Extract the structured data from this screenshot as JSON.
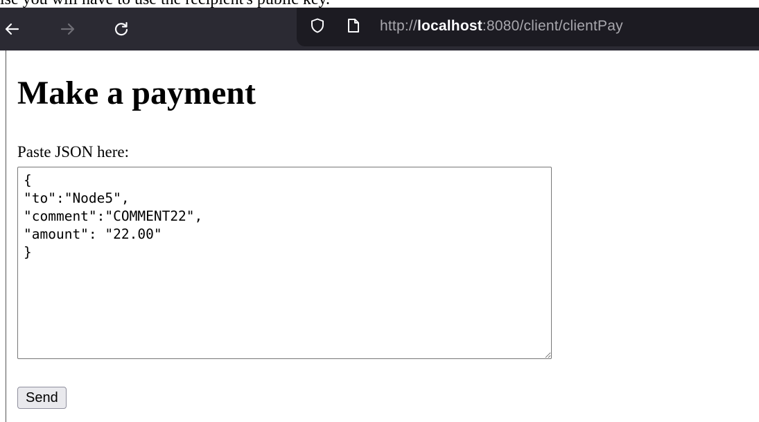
{
  "document_above": {
    "clipped_text": "ise you will have to use the recipient's public key."
  },
  "browser": {
    "back_icon": "back-arrow-icon",
    "forward_icon": "forward-arrow-icon",
    "reload_icon": "reload-icon",
    "tracking_protection_icon": "shield-icon",
    "page_icon": "document-icon",
    "url": {
      "scheme": "http://",
      "host": "localhost",
      "rest": ":8080/client/clientPay"
    },
    "colors": {
      "toolbar_bg": "#2b2a33",
      "urlbar_bg": "#1c1b22",
      "host_text": "#fbfbfe",
      "url_text": "#a8a7ad"
    }
  },
  "page": {
    "title": "Make a payment",
    "json_label": "Paste JSON here:",
    "json_value": "{\n\"to\":\"Node5\",\n\"comment\":\"COMMENT22\",\n\"amount\": \"22.00\"\n}",
    "send_label": "Send"
  }
}
